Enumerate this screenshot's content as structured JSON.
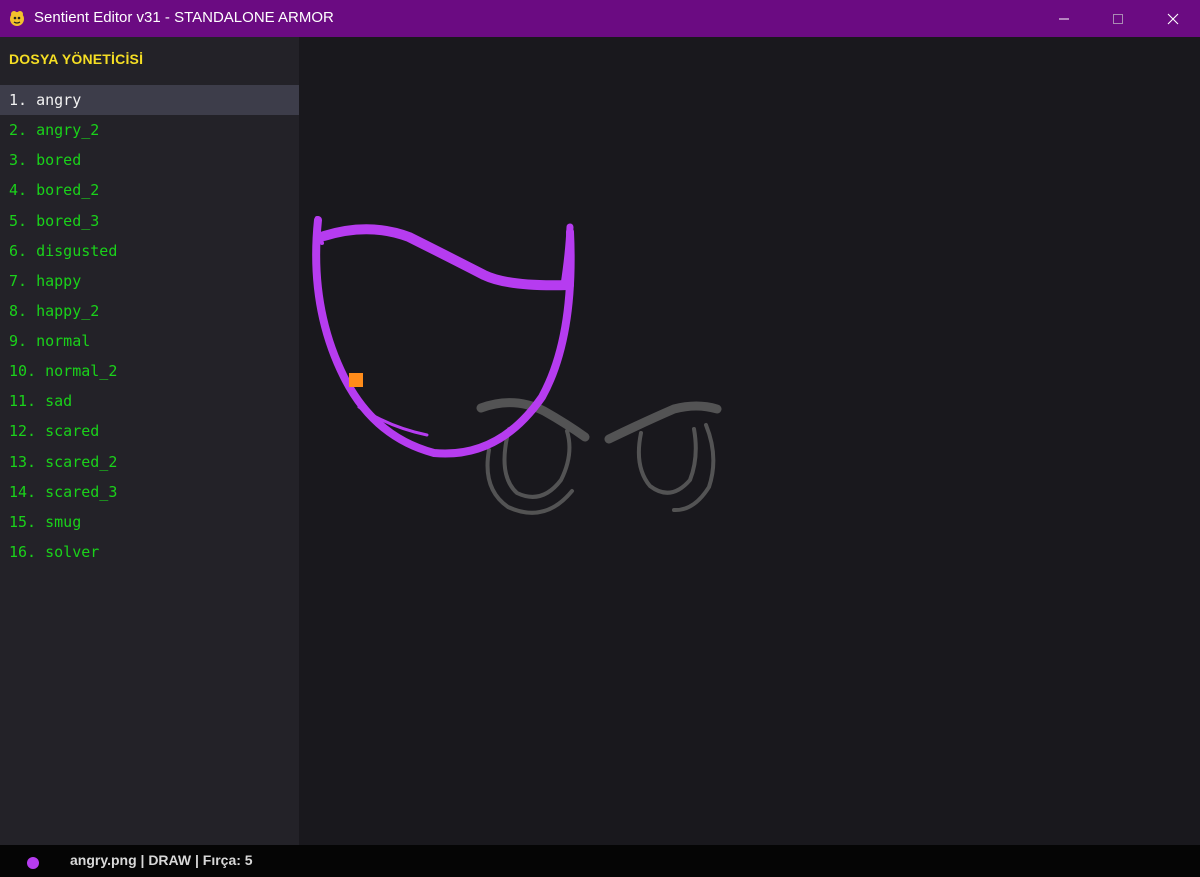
{
  "window": {
    "title": "Sentient Editor v31 - STANDALONE ARMOR",
    "titlebar_color": "#6b0b82",
    "controls": [
      "minimize-icon",
      "maximize-icon",
      "close-icon"
    ]
  },
  "sidebar": {
    "title": "DOSYA YÖNETİCİSİ",
    "title_color": "#f5de24",
    "item_color": "#1ad21a",
    "selected_index": 0,
    "items": [
      {
        "label": "1. angry"
      },
      {
        "label": "2. angry_2"
      },
      {
        "label": "3. bored"
      },
      {
        "label": "4. bored_2"
      },
      {
        "label": "5. bored_3"
      },
      {
        "label": "6. disgusted"
      },
      {
        "label": "7. happy"
      },
      {
        "label": "8. happy_2"
      },
      {
        "label": "9. normal"
      },
      {
        "label": "10. normal_2"
      },
      {
        "label": "11. sad"
      },
      {
        "label": "12. scared"
      },
      {
        "label": "13. scared_2"
      },
      {
        "label": "14. scared_3"
      },
      {
        "label": "15. smug"
      },
      {
        "label": "16. solver"
      }
    ]
  },
  "canvas": {
    "background": "#19181d",
    "stroke_color": "#b63cf0",
    "cursor_color": "#ff8c1a",
    "reference_color": "#5a5a5a"
  },
  "status": {
    "brush_color": "#b63cf0",
    "text": "angry.png | DRAW | Fırça: 5"
  }
}
